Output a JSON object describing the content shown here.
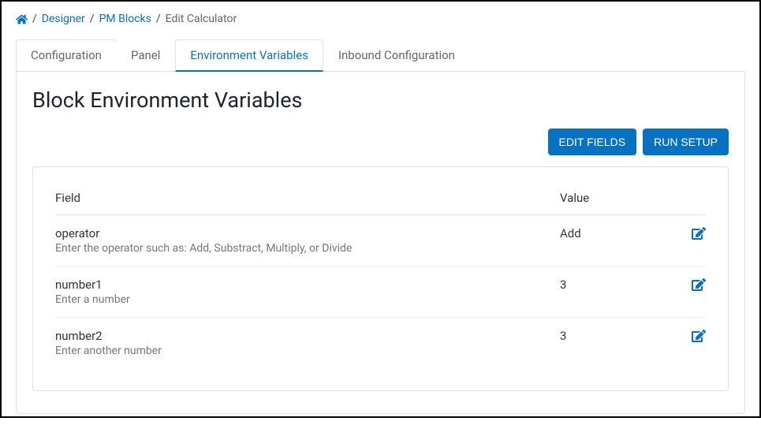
{
  "breadcrumb": {
    "items": [
      {
        "label": "Designer"
      },
      {
        "label": "PM Blocks"
      }
    ],
    "current": "Edit Calculator"
  },
  "tabs": {
    "configuration": "Configuration",
    "panel": "Panel",
    "env_vars": "Environment Variables",
    "inbound": "Inbound Configuration"
  },
  "page_title": "Block Environment Variables",
  "actions": {
    "edit_fields": "EDIT FIELDS",
    "run_setup": "RUN SETUP"
  },
  "table": {
    "header_field": "Field",
    "header_value": "Value",
    "rows": [
      {
        "name": "operator",
        "desc": "Enter the operator such as: Add, Substract, Multiply, or Divide",
        "value": "Add"
      },
      {
        "name": "number1",
        "desc": "Enter a number",
        "value": "3"
      },
      {
        "name": "number2",
        "desc": "Enter another number",
        "value": "3"
      }
    ]
  }
}
